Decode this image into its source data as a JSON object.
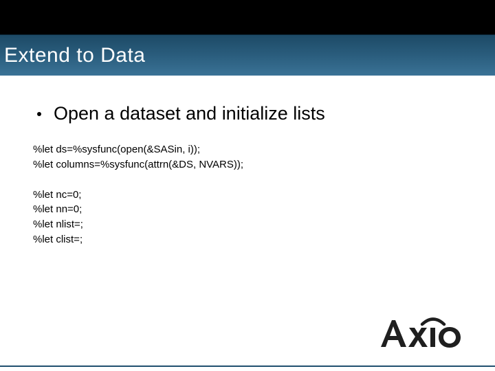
{
  "title": "Extend to Data",
  "bullet": "Open a dataset and initialize lists",
  "code": {
    "l1": "%let ds=%sysfunc(open(&SASin, i));",
    "l2": "%let columns=%sysfunc(attrn(&DS, NVARS));",
    "l3": "%let nc=0;",
    "l4": "%let nn=0;",
    "l5": "%let nlist=;",
    "l6": "%let clist=;"
  },
  "logo_text": "Axio"
}
